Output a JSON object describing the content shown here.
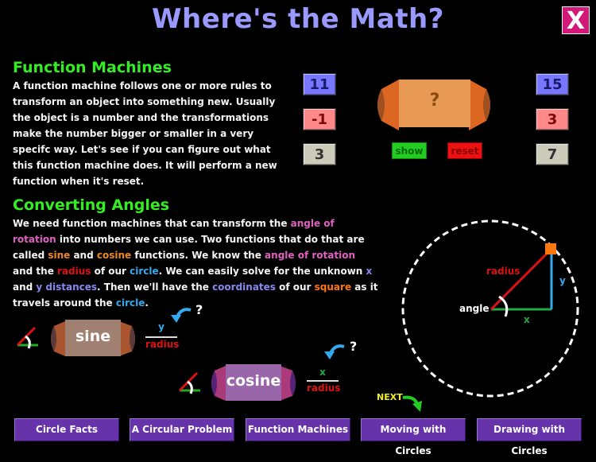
{
  "header": {
    "title": "Where's the Math?",
    "close_label": "X"
  },
  "function_machines": {
    "heading": "Function Machines",
    "paragraph": "A function machine follows one or more rules to transform an object into something new. Usually the object is a number and the transformations make the number bigger or smaller in a very specifc way. Let's see if you can figure out what this function machine does. It will perform a new function when it's reset.",
    "machine_label": "?",
    "inputs": [
      "11",
      "-1",
      "3"
    ],
    "outputs": [
      "15",
      "3",
      "7"
    ],
    "show_label": "show",
    "reset_label": "reset"
  },
  "converting_angles": {
    "heading": "Converting Angles",
    "p": [
      "We need function machines that can transform the ",
      "angle of rotation",
      " into numbers we can use. Two functions that do that are called ",
      "sine",
      " and ",
      "cosine",
      " functions. We know the ",
      "angle of rotation",
      " and the ",
      "radius",
      " of our ",
      "circle",
      ". We can easily solve for the unknown ",
      "x",
      " and ",
      "y distances",
      ". Then we'll have the ",
      "coordinates",
      " of our ",
      "square",
      " as it travels around the ",
      "circle",
      "."
    ],
    "sine": {
      "label": "sine",
      "numerator": "y",
      "denominator": "radius",
      "question": "?"
    },
    "cosine": {
      "label": "cosine",
      "numerator": "x",
      "denominator": "radius",
      "question": "?"
    }
  },
  "diagram": {
    "radius_label": "radius",
    "y_label": "y",
    "x_label": "x",
    "angle_label": "angle"
  },
  "next_label": "NEXT",
  "nav": [
    {
      "label": "Circle Facts"
    },
    {
      "label": "A Circular Problem"
    },
    {
      "label": "Function Machines"
    },
    {
      "label": "Moving with Circles"
    },
    {
      "label": "Drawing with Circles"
    }
  ],
  "colors": {
    "title": "#9999ff",
    "heading": "#33ee22",
    "close": "#d4187a",
    "nav": "#6633aa"
  }
}
